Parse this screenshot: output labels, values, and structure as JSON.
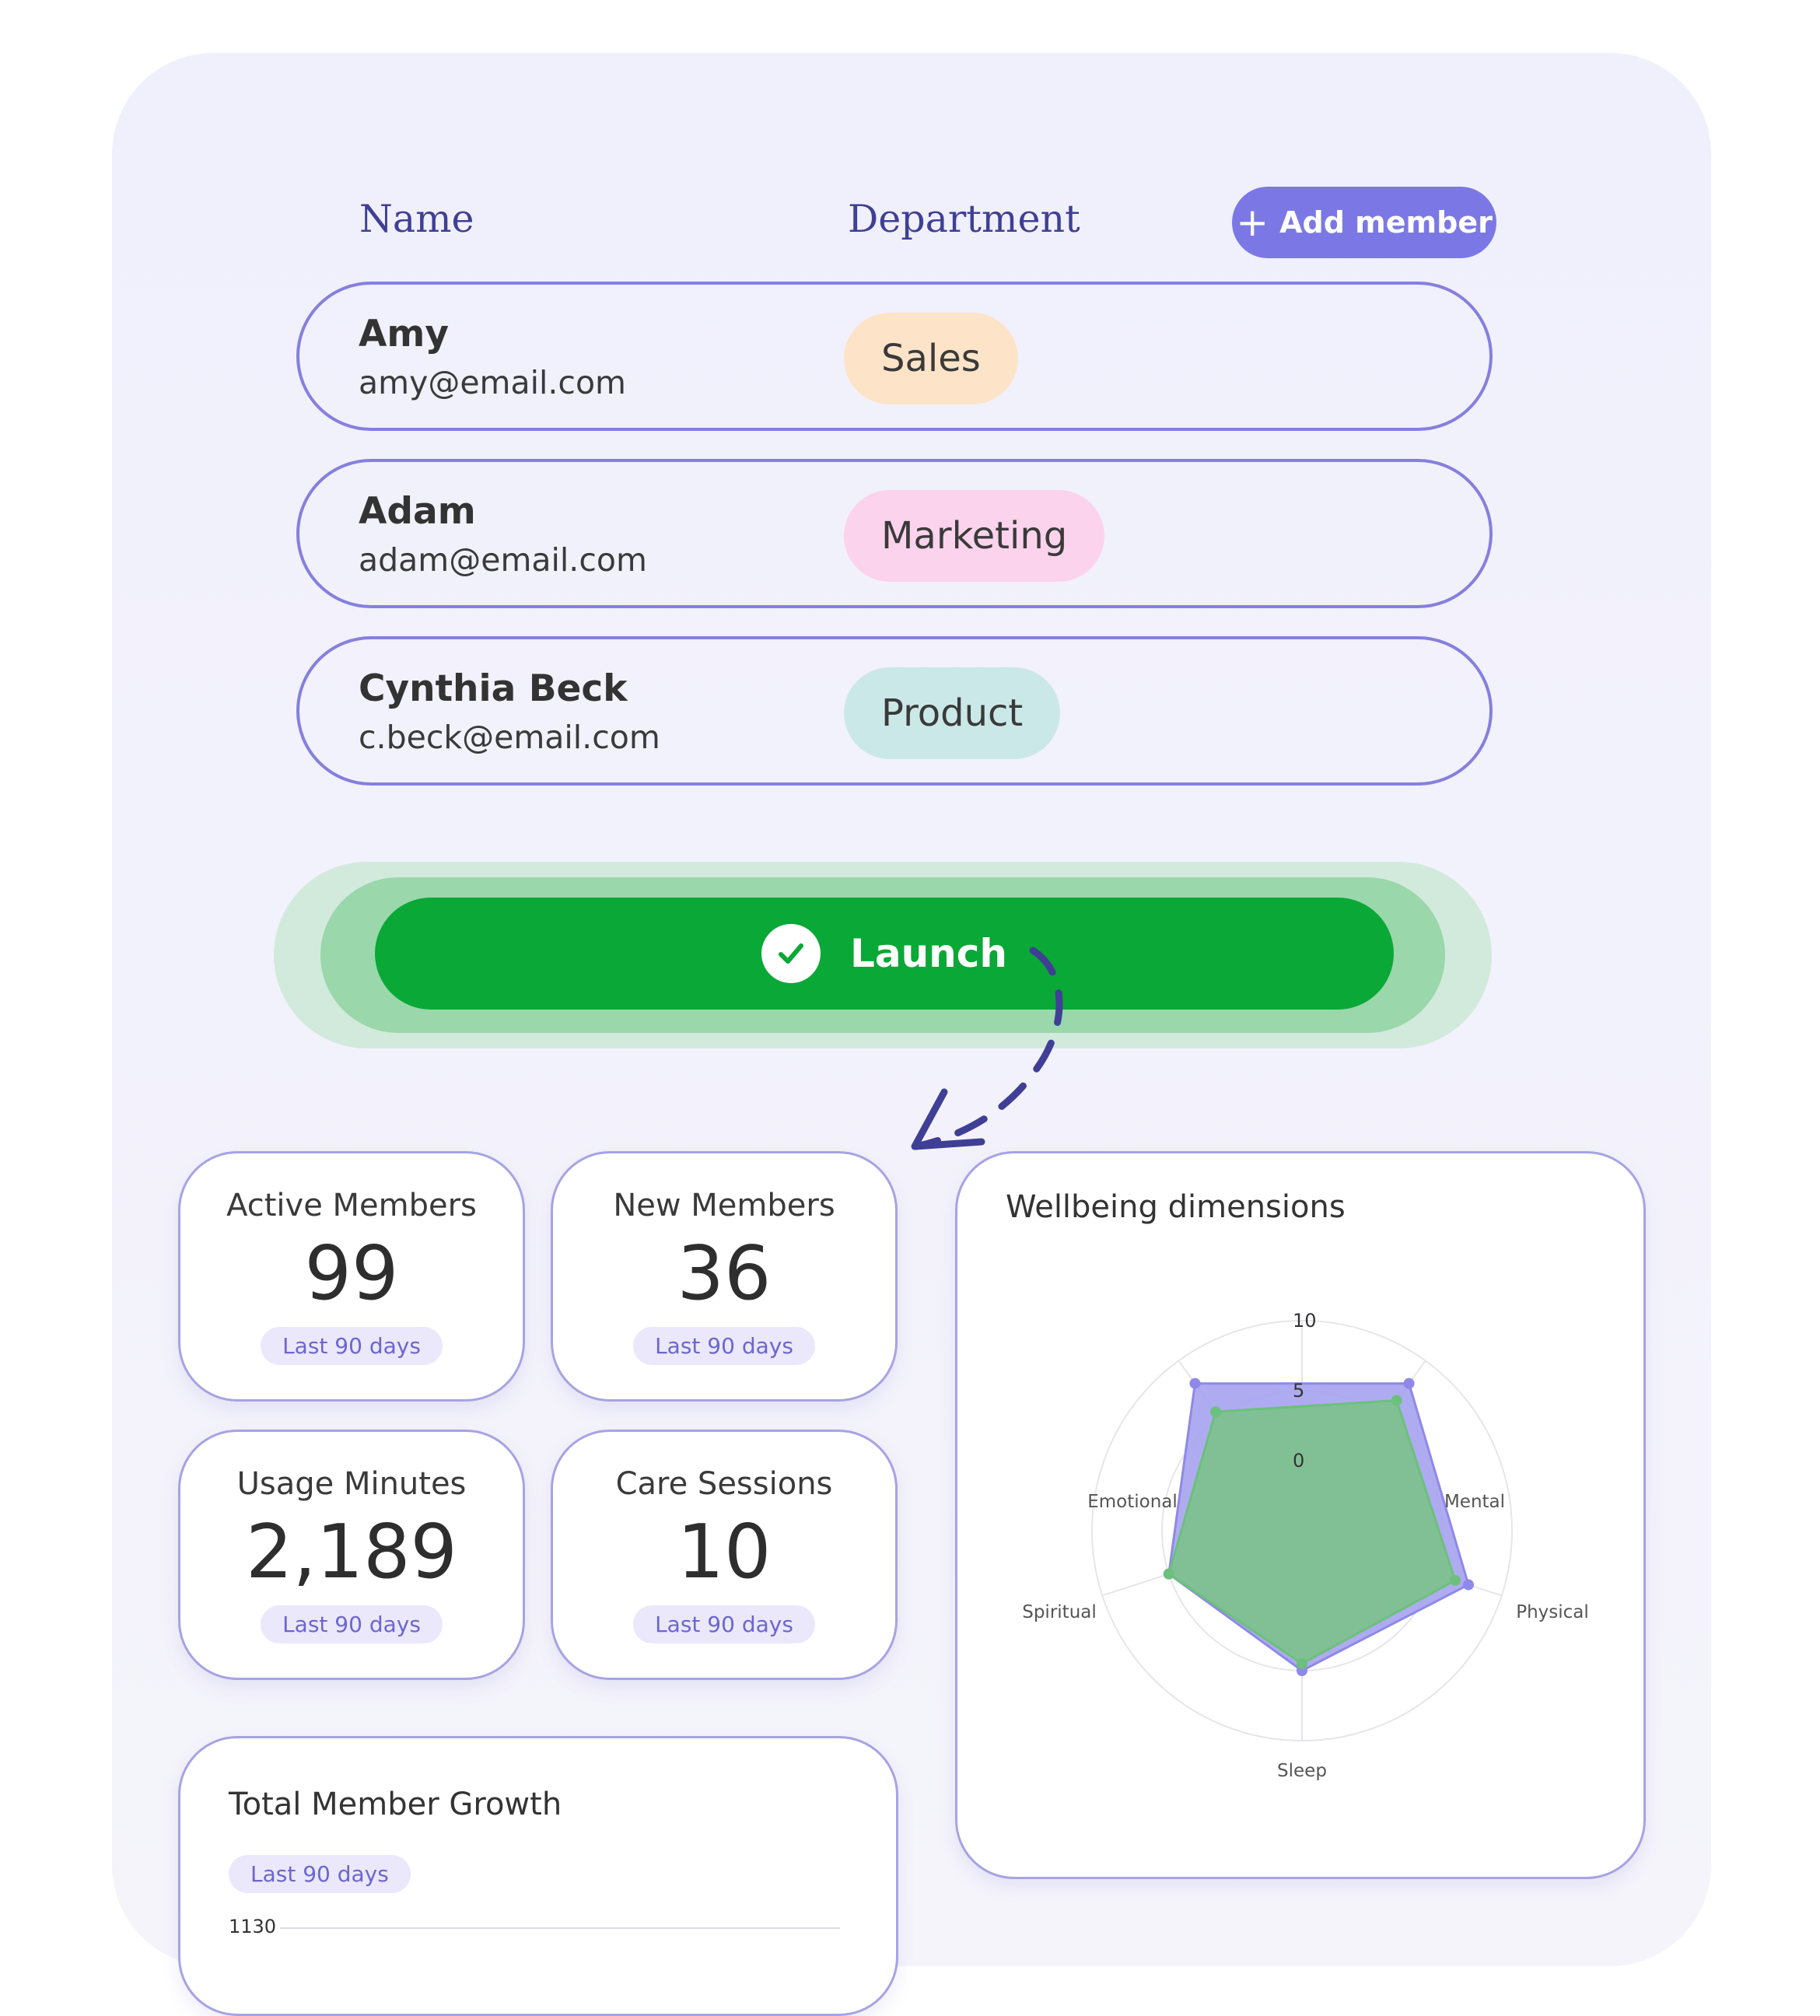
{
  "table": {
    "headers": {
      "name": "Name",
      "department": "Department"
    },
    "add_label": "Add member",
    "rows": [
      {
        "name": "Amy",
        "email": "amy@email.com",
        "department": "Sales",
        "dept_color": "#fde4c8"
      },
      {
        "name": "Adam",
        "email": "adam@email.com",
        "department": "Marketing",
        "dept_color": "#fcd3ec"
      },
      {
        "name": "Cynthia Beck",
        "email": "c.beck@email.com",
        "department": "Product",
        "dept_color": "#cbe8e8"
      }
    ]
  },
  "launch": {
    "label": "Launch",
    "color": "#0aa836"
  },
  "stats": [
    {
      "label": "Active Members",
      "value": "99",
      "period": "Last 90 days"
    },
    {
      "label": "New Members",
      "value": "36",
      "period": "Last 90 days"
    },
    {
      "label": "Usage Minutes",
      "value": "2,189",
      "period": "Last 90 days"
    },
    {
      "label": "Care Sessions",
      "value": "10",
      "period": "Last 90 days"
    }
  ],
  "growth": {
    "title": "Total Member Growth",
    "period": "Last 90 days",
    "tick": "1130"
  },
  "chart_data": {
    "type": "radar",
    "title": "Wellbeing dimensions",
    "axes": [
      "Mental",
      "Physical",
      "Sleep",
      "Spiritual",
      "Emotional"
    ],
    "ticks": [
      "0",
      "5",
      "10"
    ],
    "rmin": 0,
    "rmax": 10,
    "series": [
      {
        "values": [
          8,
          7.5,
          5,
          5,
          8
        ],
        "color": "#a6a2ef",
        "stroke": "#8e89e8"
      },
      {
        "values": [
          6.5,
          6.5,
          4.5,
          5,
          5.5
        ],
        "color": "#7cc28a",
        "stroke": "#6cc07d"
      }
    ]
  }
}
